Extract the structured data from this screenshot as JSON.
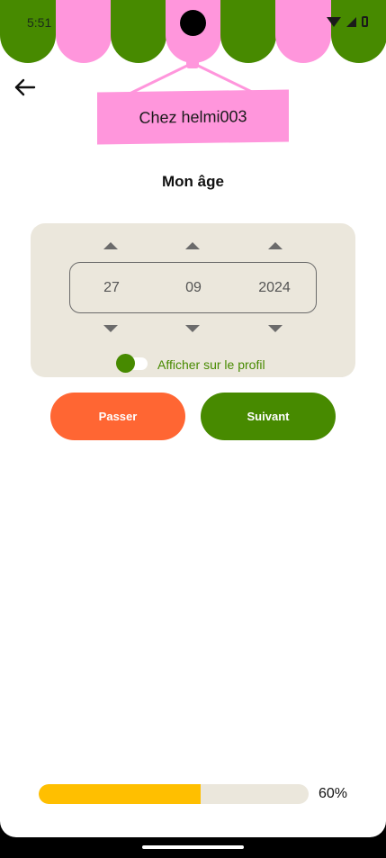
{
  "status_bar": {
    "time": "5:51"
  },
  "header": {
    "shop_name": "Chez helmi003"
  },
  "page": {
    "title": "Mon âge"
  },
  "date_picker": {
    "day": "27",
    "month": "09",
    "year": "2024"
  },
  "profile_toggle": {
    "label": "Afficher sur le profil",
    "on": true
  },
  "actions": {
    "skip_label": "Passer",
    "next_label": "Suivant"
  },
  "progress": {
    "value": 0.6,
    "label": "60%"
  },
  "colors": {
    "green": "#478a00",
    "pink": "#ff96dc",
    "orange": "#ff6633",
    "yellow": "#ffbf00",
    "beige": "#ebe7dc"
  },
  "icons": {
    "back": "arrow-left-icon",
    "increment": "caret-up-icon",
    "decrement": "caret-down-icon"
  }
}
